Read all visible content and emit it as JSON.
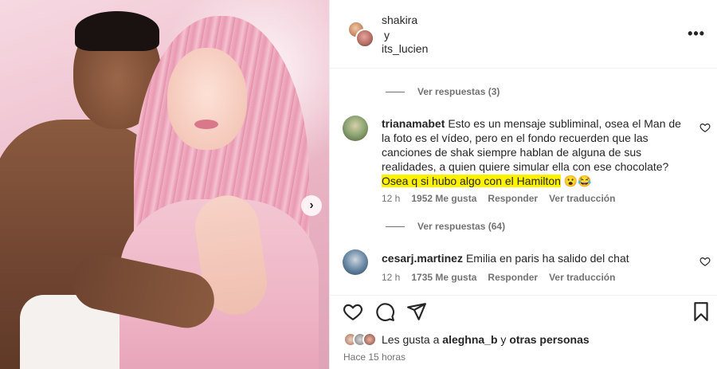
{
  "header": {
    "user1": "shakira",
    "connector": "y",
    "user2": "its_lucien",
    "more_icon": "more-horizontal-icon"
  },
  "comments": {
    "view_replies_top": "Ver respuestas (3)",
    "items": [
      {
        "username": "trianamabet",
        "text_plain": "Esto es un mensaje subliminal, osea el Man de la foto es el vídeo, pero en el fondo recuerden que las canciones de shak siempre hablan de alguna de sus realidades, a quien quiere simular ella con ese chocolate?",
        "text_highlight": "Osea q si hubo algo con el Hamilton",
        "emoji": "😮😂",
        "time": "12 h",
        "likes": "1952 Me gusta",
        "reply": "Responder",
        "translate": "Ver traducción"
      },
      {
        "username": "cesarj.martinez",
        "text_plain": "Emilia en paris ha salido del chat",
        "time": "12 h",
        "likes": "1735 Me gusta",
        "reply": "Responder",
        "translate": "Ver traducción"
      }
    ],
    "view_replies_middle": "Ver respuestas (64)"
  },
  "likes_line": {
    "prefix": "Les gusta a",
    "user": "aleghna_b",
    "and": "y",
    "others": "otras personas"
  },
  "timestamp": "Hace 15 horas",
  "colors": {
    "highlight": "#fff200",
    "muted": "#737373",
    "text": "#262626"
  }
}
